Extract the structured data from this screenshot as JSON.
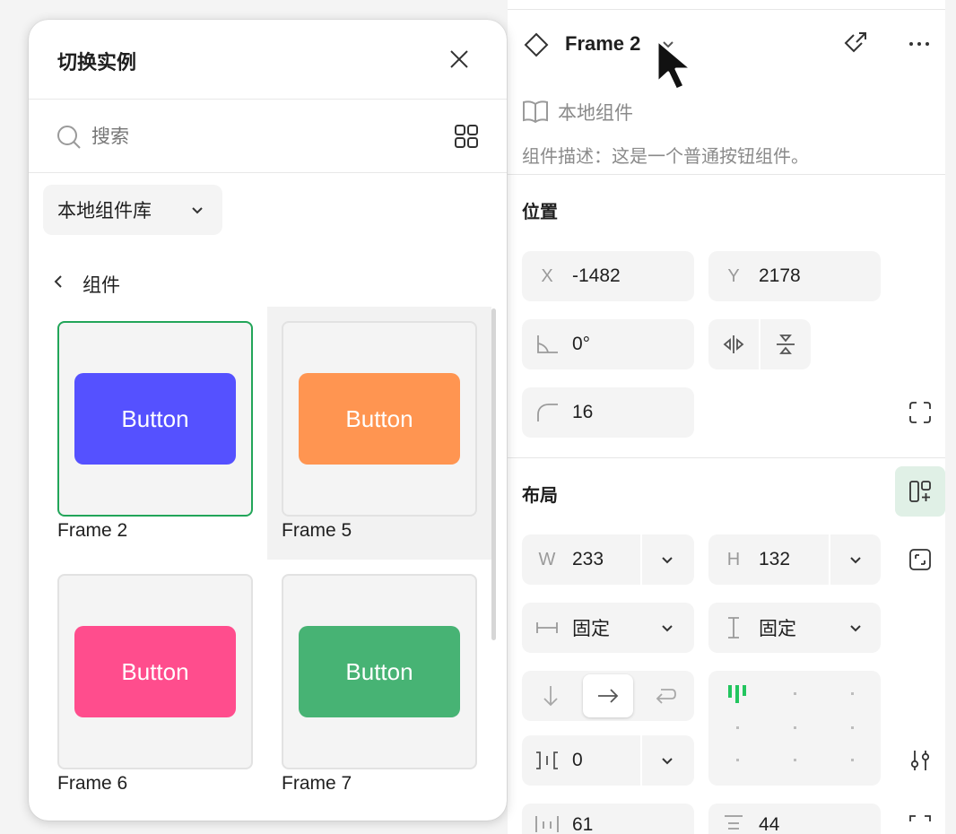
{
  "right_panel": {
    "header": {
      "title": "Frame 2"
    },
    "source": {
      "label": "本地组件"
    },
    "description": "组件描述：这是一个普通按钮组件。",
    "position": {
      "title": "位置",
      "x_label": "X",
      "x_value": "-1482",
      "y_label": "Y",
      "y_value": "2178",
      "rotation": "0°",
      "radius": "16"
    },
    "layout": {
      "title": "布局",
      "w_label": "W",
      "w_value": "233",
      "h_label": "H",
      "h_value": "132",
      "width_mode": "固定",
      "height_mode": "固定",
      "gap": "0",
      "padding_h": "61",
      "padding_v": "44"
    }
  },
  "popup": {
    "title": "切换实例",
    "search": {
      "placeholder": "搜索"
    },
    "library_select": "本地组件库",
    "breadcrumb": "组件",
    "items": [
      {
        "name": "Frame 2",
        "button_text": "Button",
        "color": "#5551ff",
        "selected": true
      },
      {
        "name": "Frame 5",
        "button_text": "Button",
        "color": "#ff9551",
        "selected": false
      },
      {
        "name": "Frame 6",
        "button_text": "Button",
        "color": "#ff4d8d",
        "selected": false
      },
      {
        "name": "Frame 7",
        "button_text": "Button",
        "color": "#47b374",
        "selected": false
      }
    ]
  },
  "colors": {
    "accent_green": "#22a559",
    "active_toggle_bg": "#e0f0e6",
    "align_indicator": "#22c55e"
  }
}
